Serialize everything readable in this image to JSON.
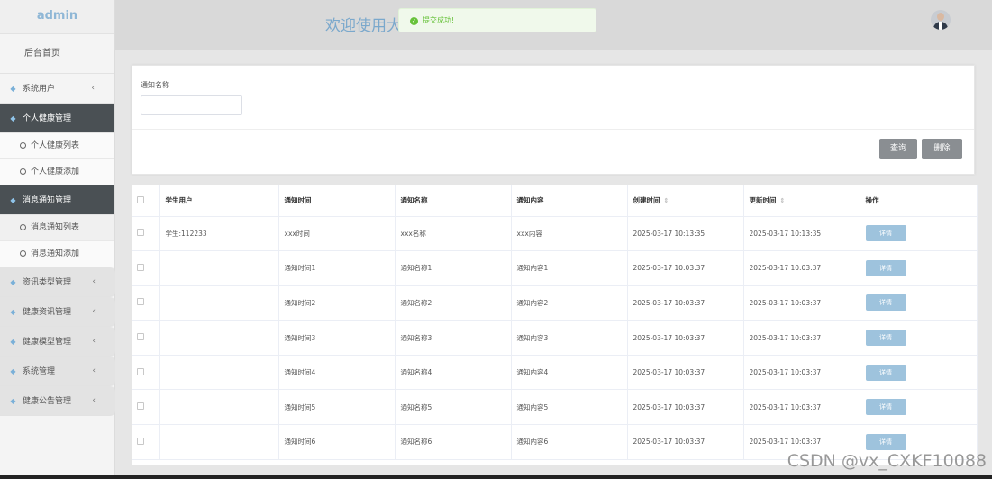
{
  "brand": "admin",
  "sidebar": {
    "home": "后台首页",
    "items": [
      {
        "label": "系统用户",
        "chev": "‹"
      },
      {
        "label": "个人健康管理",
        "active": true,
        "subs": [
          "个人健康列表",
          "个人健康添加"
        ]
      },
      {
        "label": "消息通知管理",
        "active": true,
        "subs": [
          "消息通知列表",
          "消息通知添加"
        ]
      },
      {
        "label": "资讯类型管理",
        "chev": "‹"
      },
      {
        "label": "健康资讯管理",
        "chev": "‹"
      },
      {
        "label": "健康模型管理",
        "chev": "‹"
      },
      {
        "label": "系统管理",
        "chev": "‹"
      },
      {
        "label": "健康公告管理",
        "chev": "‹"
      }
    ]
  },
  "header": {
    "welcome": "欢迎使用大",
    "toast": "提交成功!"
  },
  "search": {
    "label": "通知名称",
    "value": "",
    "query_btn": "查询",
    "delete_btn": "删除"
  },
  "table": {
    "headers": [
      "学生用户",
      "通知时间",
      "通知名称",
      "通知内容",
      "创建时间",
      "更新时间",
      "操作"
    ],
    "sort_icon": "⇕",
    "detail_label": "详情",
    "rows": [
      [
        "学生:112233",
        "xxx时间",
        "xxx名称",
        "xxx内容",
        "2025-03-17 10:13:35",
        "2025-03-17 10:13:35"
      ],
      [
        "",
        "通知时间1",
        "通知名称1",
        "通知内容1",
        "2025-03-17 10:03:37",
        "2025-03-17 10:03:37"
      ],
      [
        "",
        "通知时间2",
        "通知名称2",
        "通知内容2",
        "2025-03-17 10:03:37",
        "2025-03-17 10:03:37"
      ],
      [
        "",
        "通知时间3",
        "通知名称3",
        "通知内容3",
        "2025-03-17 10:03:37",
        "2025-03-17 10:03:37"
      ],
      [
        "",
        "通知时间4",
        "通知名称4",
        "通知内容4",
        "2025-03-17 10:03:37",
        "2025-03-17 10:03:37"
      ],
      [
        "",
        "通知时间5",
        "通知名称5",
        "通知内容5",
        "2025-03-17 10:03:37",
        "2025-03-17 10:03:37"
      ],
      [
        "",
        "通知时间6",
        "通知名称6",
        "通知内容6",
        "2025-03-17 10:03:37",
        "2025-03-17 10:03:37"
      ]
    ]
  },
  "watermark": "CSDN @vx_CXKF10088",
  "colors": {
    "accent": "#8fb7d6",
    "active_menu": "#4a5054",
    "toast_bg": "#f0f9eb",
    "toast_text": "#67c23a",
    "detail_btn": "#9ec3dd"
  }
}
